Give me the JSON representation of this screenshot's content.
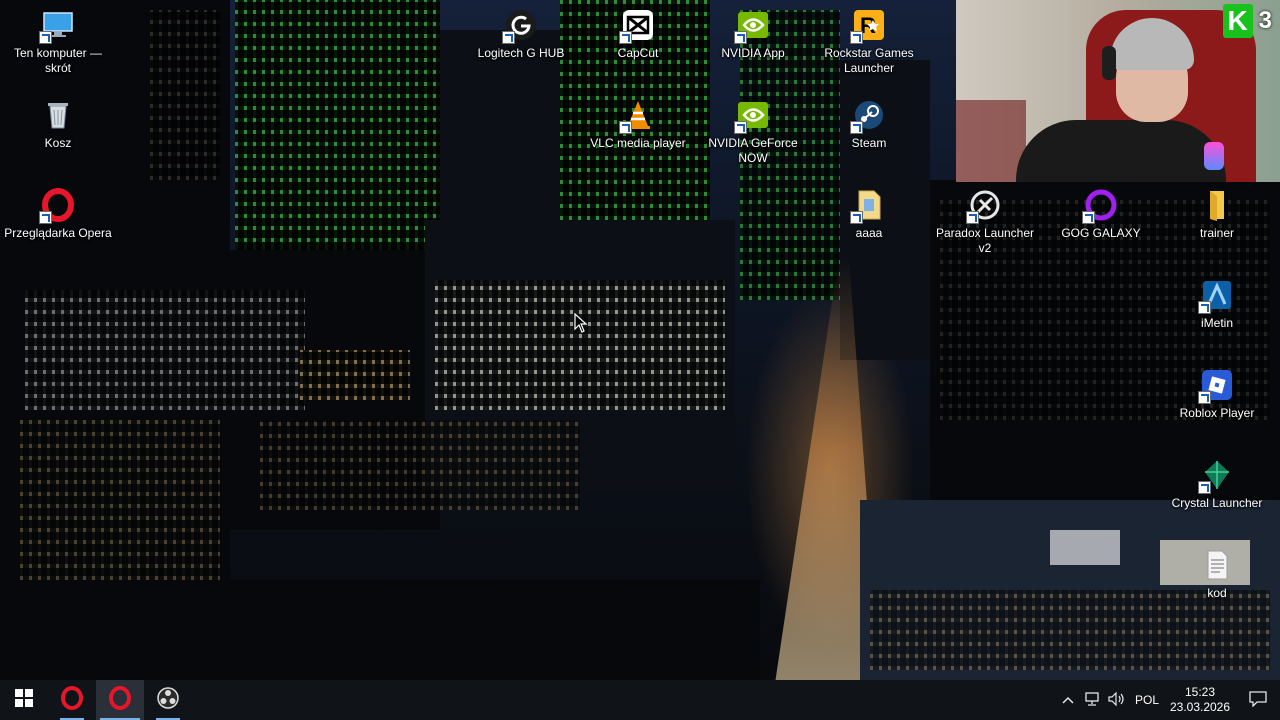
{
  "desktop": {
    "icons": [
      {
        "label": "Ten komputer — skrót",
        "icon": "this-pc-icon"
      },
      {
        "label": "Kosz",
        "icon": "recycle-bin-icon"
      },
      {
        "label": "Przeglądarka Opera",
        "icon": "opera-icon"
      },
      {
        "label": "Logitech G HUB",
        "icon": "logitech-ghub-icon"
      },
      {
        "label": "CapCut",
        "icon": "capcut-icon"
      },
      {
        "label": "NVIDIA App",
        "icon": "nvidia-icon"
      },
      {
        "label": "Rockstar Games Launcher",
        "icon": "rockstar-icon"
      },
      {
        "label": "VLC media player",
        "icon": "vlc-icon"
      },
      {
        "label": "NVIDIA GeForce NOW",
        "icon": "nvidia-icon"
      },
      {
        "label": "Steam",
        "icon": "steam-icon"
      },
      {
        "label": "aaaa",
        "icon": "file-icon"
      },
      {
        "label": "Paradox Launcher v2",
        "icon": "paradox-icon"
      },
      {
        "label": "GOG GALAXY",
        "icon": "gog-galaxy-icon"
      },
      {
        "label": "trainer",
        "icon": "folder-icon"
      },
      {
        "label": "iMetin",
        "icon": "imetin-icon"
      },
      {
        "label": "Roblox Player",
        "icon": "roblox-icon"
      },
      {
        "label": "Crystal Launcher",
        "icon": "crystal-launcher-icon"
      },
      {
        "label": "kod",
        "icon": "text-file-icon"
      }
    ]
  },
  "webcam": {
    "badge_letter": "K",
    "badge_number": "3",
    "badge_color": "#18c21d"
  },
  "taskbar": {
    "start_icon": "windows-start-icon",
    "pinned": [
      {
        "icon": "opera-icon"
      },
      {
        "icon": "opera-icon"
      },
      {
        "icon": "obs-icon"
      }
    ],
    "tray": {
      "language": "POL",
      "time": "15:23",
      "date": "23.03.2026"
    }
  },
  "colors": {
    "taskbar_bg": "#101318",
    "opera_red": "#e8162b",
    "nvidia_green": "#76b900",
    "accent_blue": "#7ab3e8"
  }
}
